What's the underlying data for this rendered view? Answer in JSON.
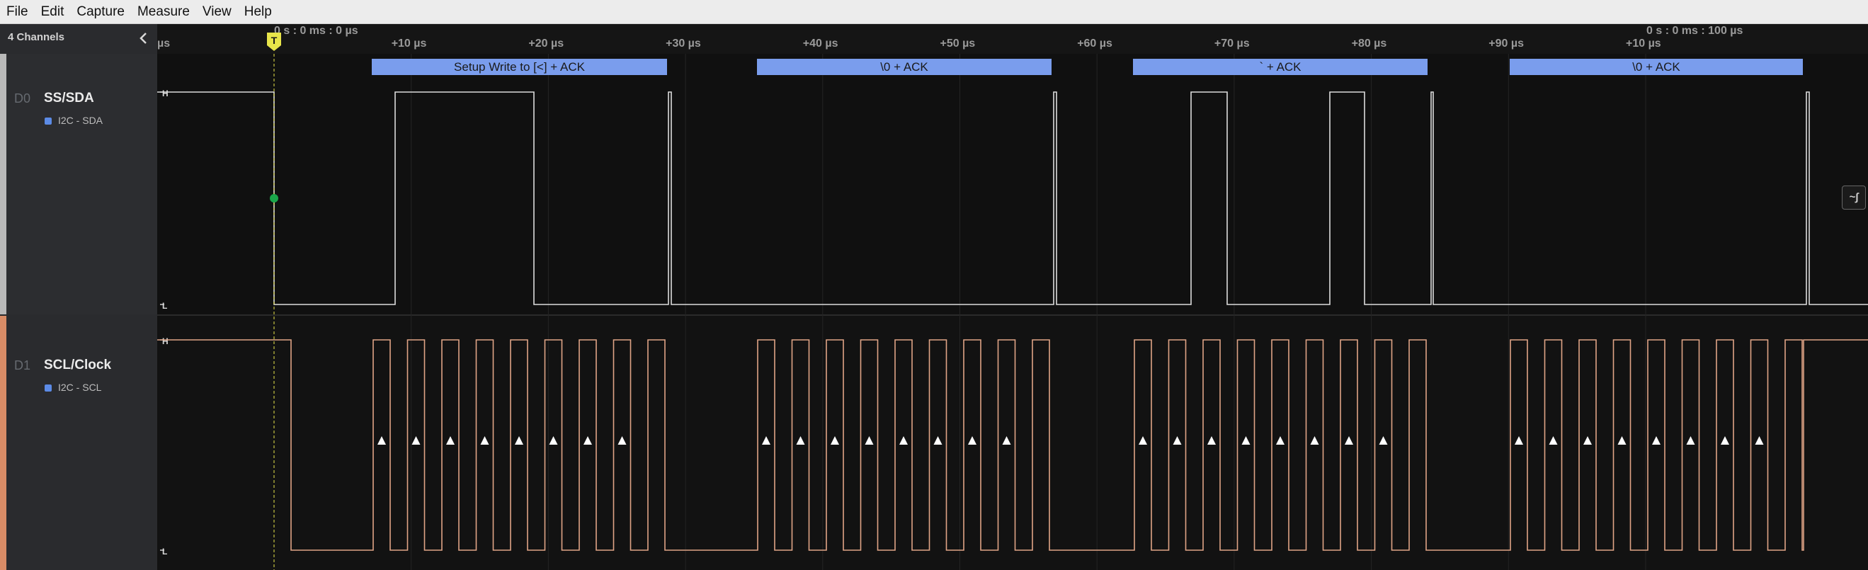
{
  "menu": [
    "File",
    "Edit",
    "Capture",
    "Measure",
    "View",
    "Help"
  ],
  "sidebar": {
    "title": "4 Channels",
    "collapse_icon": "chevron-left-icon",
    "channels": [
      {
        "num": "D0",
        "name": "SS/SDA",
        "analyzer": "I2C - SDA",
        "color": "#dcdcdc",
        "strip_color": "#b9b9b9"
      },
      {
        "num": "D1",
        "name": "SCL/Clock",
        "analyzer": "I2C - SCL",
        "color": "#e0a486",
        "strip_color": "#d98c66"
      }
    ]
  },
  "timeline": {
    "trigger_marker": "T",
    "left_unit": "µs",
    "abs_time_start": "0 s : 0 ms : 0 µs",
    "abs_time_mid": "0 s : 0 ms : 100 µs",
    "ticks": [
      "+10 µs",
      "+20 µs",
      "+30 µs",
      "+40 µs",
      "+50 µs",
      "+60 µs",
      "+70 µs",
      "+80 µs",
      "+90 µs",
      "+10 µs"
    ]
  },
  "levels": {
    "high": "H",
    "low": "L"
  },
  "frames": [
    "Setup Write to [<] + ACK",
    "\\0 + ACK",
    "` + ACK",
    "\\0 + ACK"
  ],
  "colors": {
    "background": "#111111",
    "frame_bubble": "#7a9ded",
    "trigger": "#e8e54a",
    "sda_line": "#dcdcdc",
    "scl_line": "#e0a486",
    "trigger_dot": "#1aa64a"
  },
  "float_button_icon": "measure-icon"
}
